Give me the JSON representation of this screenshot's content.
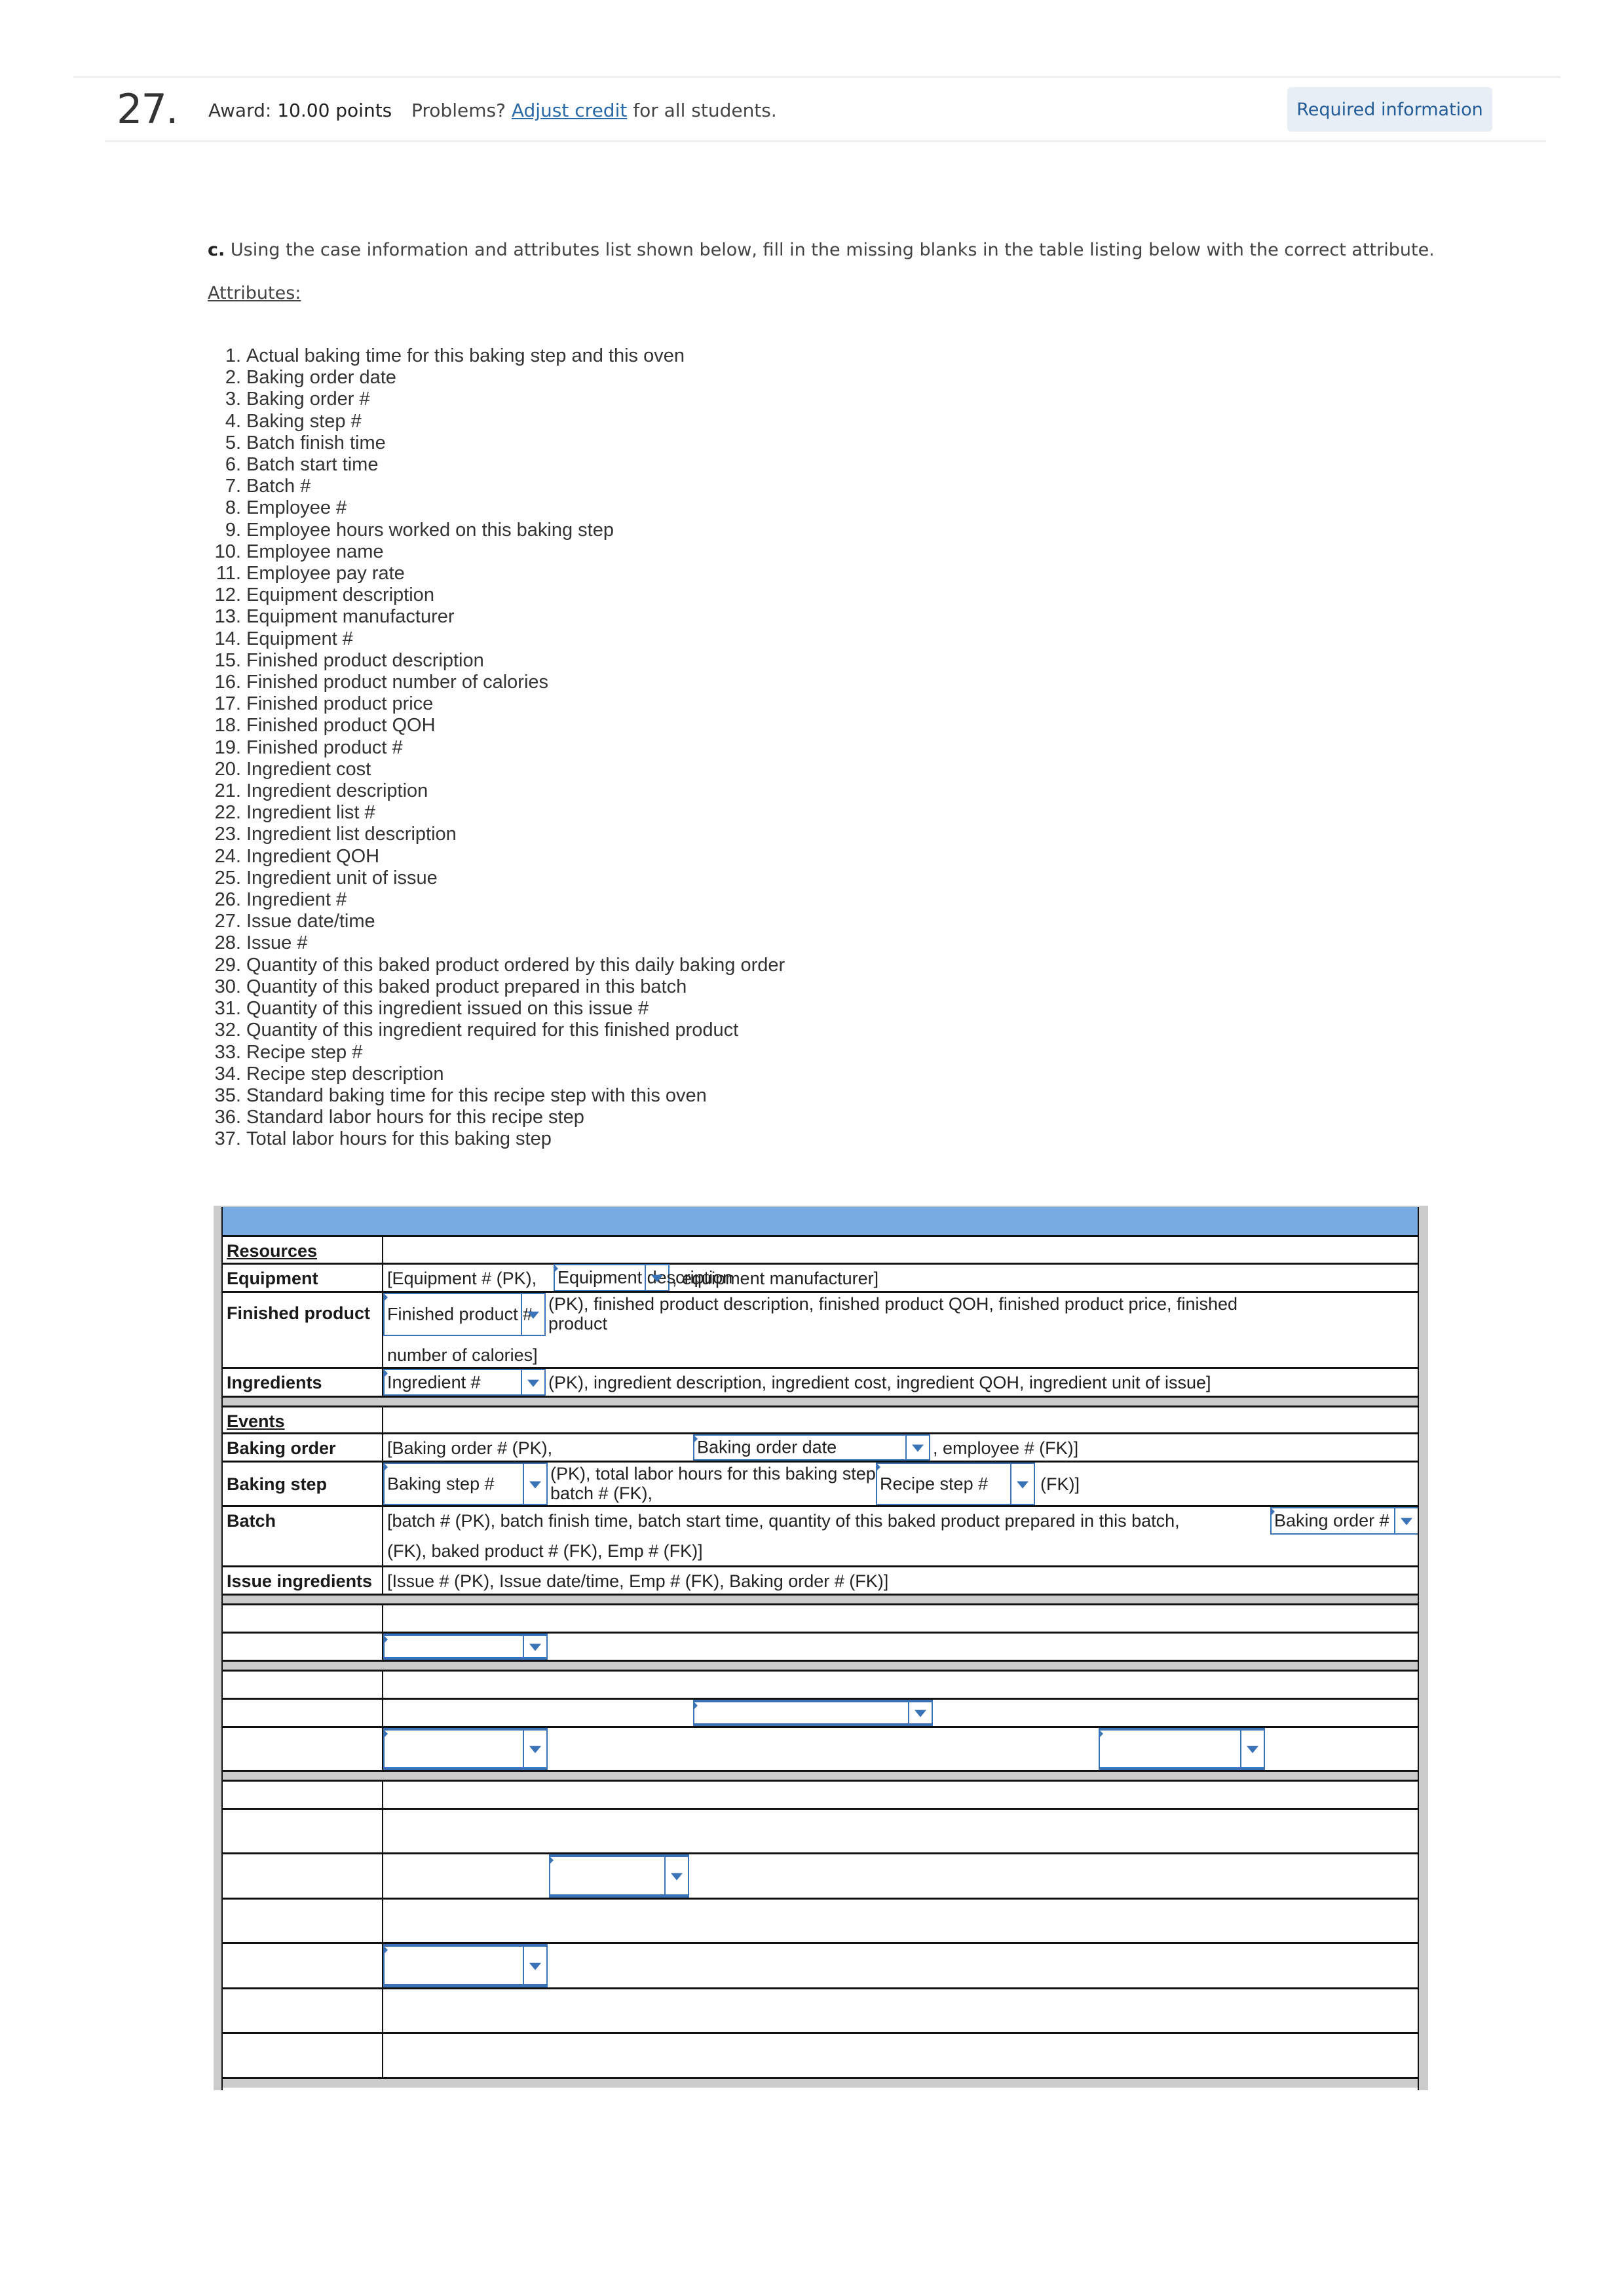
{
  "header": {
    "question_number": "27.",
    "award_label": "Award:",
    "award_value": "10.00 points",
    "problems_prefix": "Problems?",
    "adjust_credit_link": "Adjust credit",
    "problems_suffix": "for all students.",
    "required_info_button": "Required information"
  },
  "instructions": {
    "part_label": "c.",
    "text": "Using the case information and attributes list shown below, fill in the missing blanks in the table listing below with the correct attribute.",
    "attributes_heading": "Attributes:"
  },
  "attributes": [
    "Actual baking time for this baking step and this oven",
    "Baking order date",
    "Baking order #",
    "Baking step #",
    "Batch finish time",
    "Batch start time",
    "Batch #",
    "Employee #",
    "Employee hours worked on this baking step",
    "Employee name",
    "Employee pay rate",
    "Equipment description",
    "Equipment manufacturer",
    "Equipment #",
    "Finished product description",
    "Finished product number of calories",
    "Finished product price",
    "Finished product QOH",
    "Finished product #",
    "Ingredient cost",
    "Ingredient description",
    "Ingredient list #",
    "Ingredient list description",
    "Ingredient QOH",
    "Ingredient unit of issue",
    "Ingredient #",
    "Issue date/time",
    "Issue #",
    "Quantity of this baked product ordered by this daily baking order",
    "Quantity of this baked product prepared in this batch",
    "Quantity of this ingredient issued on this issue #",
    "Quantity of this ingredient required for this finished product",
    "Recipe step #",
    "Recipe step description",
    "Standard baking time for this recipe step with this oven",
    "Standard labor hours for this recipe step",
    "Total labor hours for this baking step"
  ],
  "table": {
    "resources_heading": "Resources",
    "equipment": {
      "label": "Equipment",
      "prefix": "[Equipment # (PK),",
      "dropdown": "Equipment description",
      "suffix": ", equipment manufacturer]"
    },
    "finished_product": {
      "label": "Finished product",
      "dropdown": "Finished product #",
      "text_line1": "(PK), finished product description, finished product QOH, finished product price, finished",
      "text_line2": "product",
      "text_line3": "number of calories]"
    },
    "ingredients": {
      "label": "Ingredients",
      "dropdown": "Ingredient #",
      "suffix": "(PK), ingredient description, ingredient cost, ingredient QOH, ingredient unit of issue]"
    },
    "events_heading": "Events",
    "baking_order": {
      "label": "Baking order",
      "prefix": "[Baking order # (PK),",
      "dropdown": "Baking order date",
      "suffix": ", employee # (FK)]"
    },
    "baking_step": {
      "label": "Baking step",
      "dropdown1": "Baking step #",
      "middle_line1": "(PK), total labor hours for this baking step,",
      "middle_line2": "batch # (FK),",
      "dropdown2": "Recipe step #",
      "suffix": "(FK)]"
    },
    "batch": {
      "label": "Batch",
      "line1": "[batch # (PK), batch finish time, batch start time, quantity of this baked product prepared in this batch,",
      "dropdown": "Baking order #",
      "line2": "(FK), baked product # (FK), Emp # (FK)]"
    },
    "issue_ingredients": {
      "label": "Issue ingredients",
      "text": "[Issue # (PK), Issue date/time, Emp # (FK), Baking order # (FK)]"
    },
    "empty_dropdown_value": ""
  }
}
